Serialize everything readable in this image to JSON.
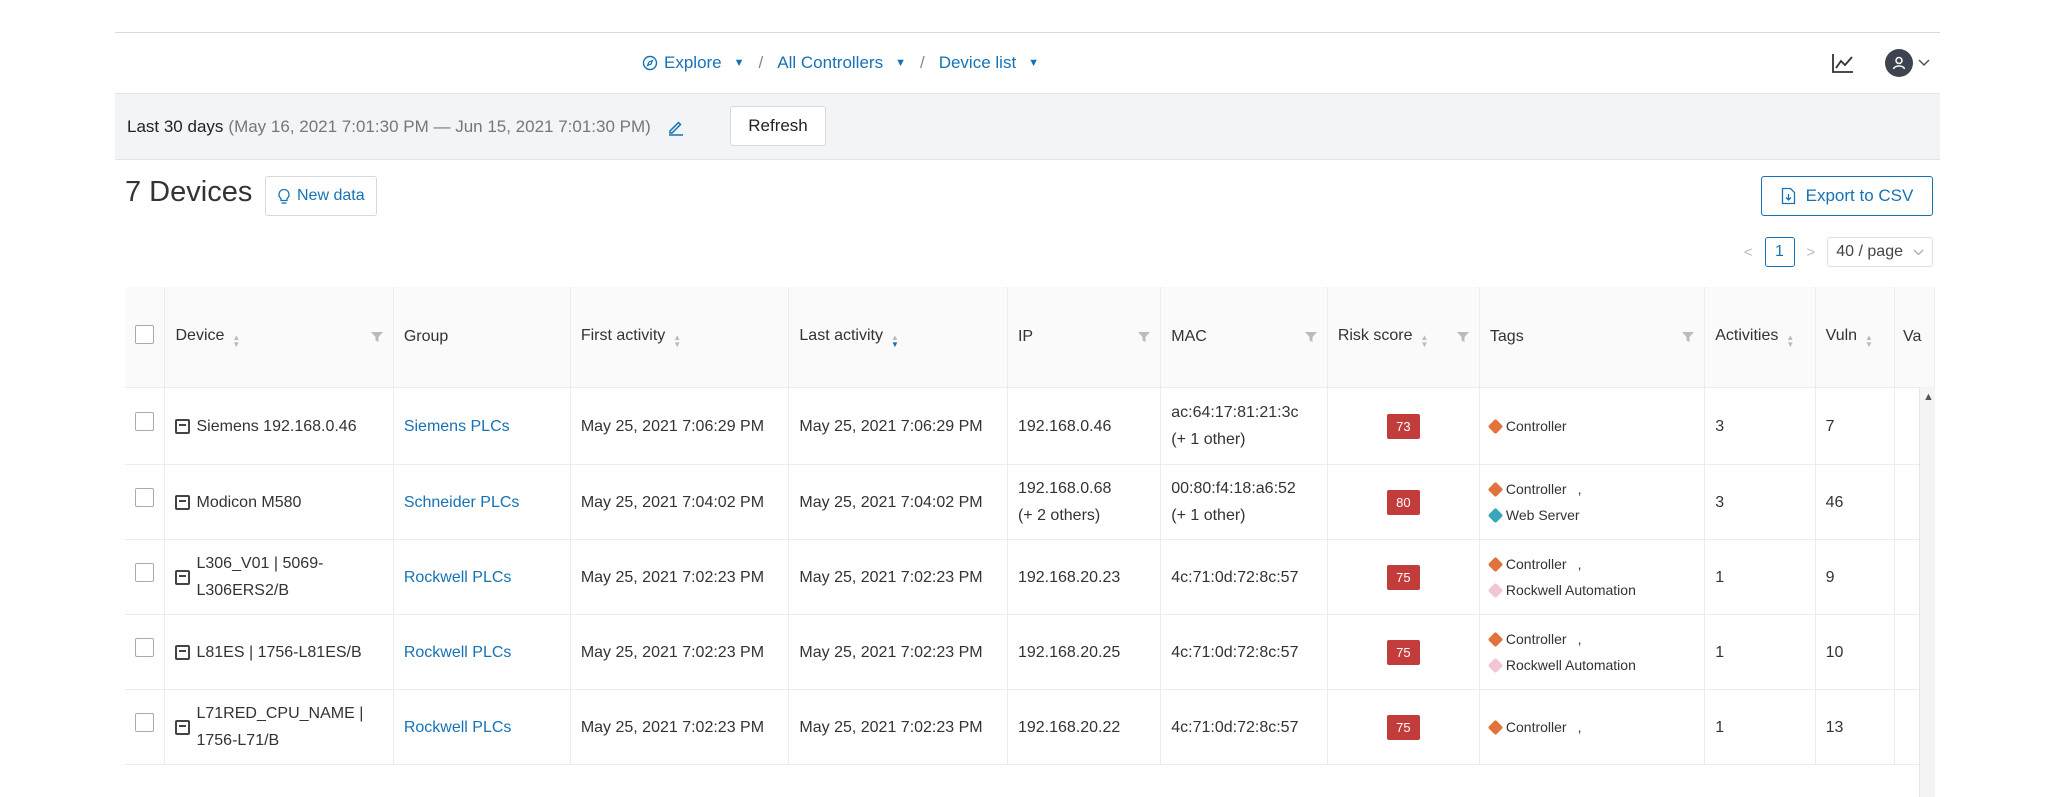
{
  "nav": {
    "crumbs": [
      {
        "label": "Explore"
      },
      {
        "label": "All Controllers"
      },
      {
        "label": "Device list"
      }
    ],
    "separator": "/"
  },
  "filter": {
    "range_label": "Last 30 days",
    "range_dates": "(May 16, 2021 7:01:30 PM — Jun 15, 2021 7:01:30 PM)",
    "refresh_label": "Refresh"
  },
  "header": {
    "title": "7 Devices",
    "new_data_label": "New data",
    "export_label": "Export to CSV"
  },
  "pagination": {
    "prev": "<",
    "page": "1",
    "next": ">",
    "page_size": "40 / page"
  },
  "table": {
    "columns": [
      "Device",
      "Group",
      "First activity",
      "Last activity",
      "IP",
      "MAC",
      "Risk score",
      "Tags",
      "Activities",
      "Vuln",
      "Va"
    ],
    "rows": [
      {
        "device": "Siemens 192.168.0.46",
        "group": "Siemens PLCs",
        "first": "May 25, 2021 7:06:29 PM",
        "last": "May 25, 2021 7:06:29 PM",
        "ip": "192.168.0.46",
        "ip2": "",
        "mac": "ac:64:17:81:21:3c",
        "mac2": "(+ 1 other)",
        "risk": "73",
        "tags": [
          {
            "label": "Controller",
            "color": "#e0743c"
          }
        ],
        "activities": "3",
        "vuln": "7"
      },
      {
        "device": "Modicon M580",
        "group": "Schneider PLCs",
        "first": "May 25, 2021 7:04:02 PM",
        "last": "May 25, 2021 7:04:02 PM",
        "ip": "192.168.0.68",
        "ip2": "(+ 2 others)",
        "mac": "00:80:f4:18:a6:52",
        "mac2": "(+ 1 other)",
        "risk": "80",
        "tags": [
          {
            "label": "Controller",
            "color": "#e0743c"
          },
          {
            "label": "Web Server",
            "color": "#3aa7b8"
          }
        ],
        "activities": "3",
        "vuln": "46"
      },
      {
        "device": "L306_V01 | 5069-L306ERS2/B",
        "group": "Rockwell PLCs",
        "first": "May 25, 2021 7:02:23 PM",
        "last": "May 25, 2021 7:02:23 PM",
        "ip": "192.168.20.23",
        "ip2": "",
        "mac": "4c:71:0d:72:8c:57",
        "mac2": "",
        "risk": "75",
        "tags": [
          {
            "label": "Controller",
            "color": "#e0743c"
          },
          {
            "label": "Rockwell Automation",
            "color": "#f2c7d3"
          }
        ],
        "activities": "1",
        "vuln": "9"
      },
      {
        "device": "L81ES | 1756-L81ES/B",
        "group": "Rockwell PLCs",
        "first": "May 25, 2021 7:02:23 PM",
        "last": "May 25, 2021 7:02:23 PM",
        "ip": "192.168.20.25",
        "ip2": "",
        "mac": "4c:71:0d:72:8c:57",
        "mac2": "",
        "risk": "75",
        "tags": [
          {
            "label": "Controller",
            "color": "#e0743c"
          },
          {
            "label": "Rockwell Automation",
            "color": "#f2c7d3"
          }
        ],
        "activities": "1",
        "vuln": "10"
      },
      {
        "device": "L71RED_CPU_NAME | 1756-L71/B",
        "group": "Rockwell PLCs",
        "first": "May 25, 2021 7:02:23 PM",
        "last": "May 25, 2021 7:02:23 PM",
        "ip": "192.168.20.22",
        "ip2": "",
        "mac": "4c:71:0d:72:8c:57",
        "mac2": "",
        "risk": "75",
        "tags": [
          {
            "label": "Controller",
            "color": "#e0743c"
          }
        ],
        "activities": "1",
        "vuln": "13"
      }
    ]
  },
  "colors": {
    "accent": "#1672b5",
    "risk": "#c23c3c"
  }
}
